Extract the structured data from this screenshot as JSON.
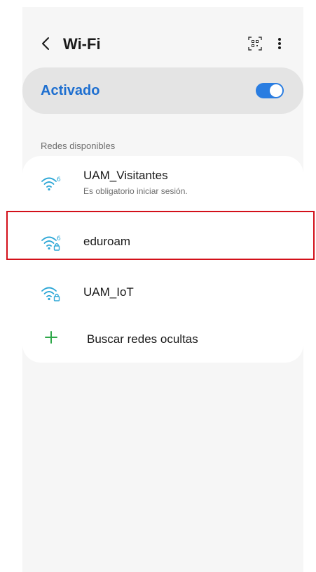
{
  "header": {
    "title": "Wi-Fi",
    "back_icon": "chevron-left-icon",
    "qr_icon": "qr-code-icon",
    "more_icon": "more-vertical-icon"
  },
  "wifi_toggle": {
    "label": "Activado",
    "state": "on"
  },
  "section": {
    "title": "Redes disponibles"
  },
  "networks": [
    {
      "name": "UAM_Visitantes",
      "subtitle": "Es obligatorio iniciar sesión.",
      "badge": "6",
      "locked": false
    },
    {
      "name": "eduroam",
      "subtitle": "",
      "badge": "6",
      "locked": true
    },
    {
      "name": "UAM_IoT",
      "subtitle": "",
      "badge": "",
      "locked": true
    }
  ],
  "add_network": {
    "label": "Buscar redes ocultas",
    "icon": "plus-icon"
  },
  "colors": {
    "accent": "#1e6fd0",
    "wifi_icon": "#2ea7d6",
    "plus_icon": "#2fa84a",
    "highlight": "#d3101a"
  }
}
